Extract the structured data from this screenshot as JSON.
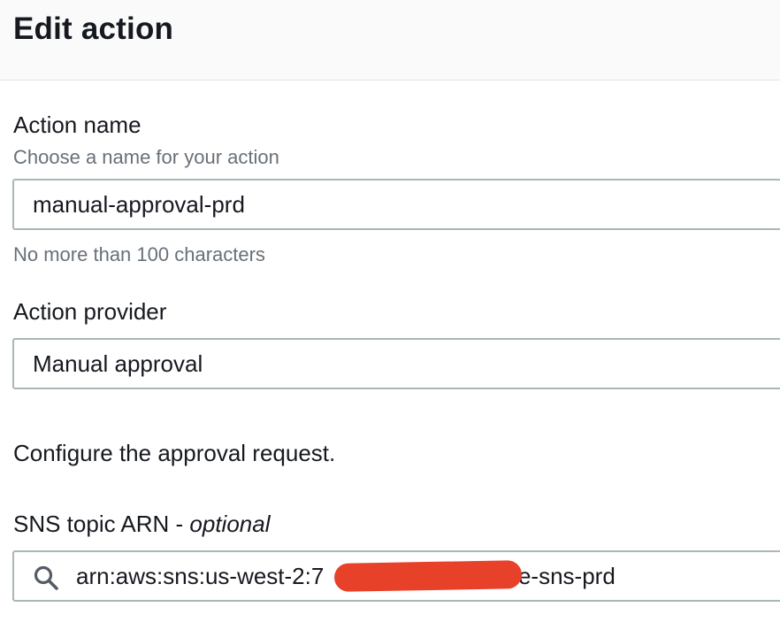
{
  "header": {
    "title": "Edit action"
  },
  "action_name": {
    "label": "Action name",
    "description": "Choose a name for your action",
    "value": "manual-approval-prd",
    "constraint": "No more than 100 characters"
  },
  "action_provider": {
    "label": "Action provider",
    "value": "Manual approval"
  },
  "approval": {
    "heading": "Configure the approval request."
  },
  "sns_topic": {
    "label": "SNS topic ARN - ",
    "label_optional": "optional",
    "value": "arn:aws:sns:us-west-2:7                    pipeline-sns-prd",
    "icon": "search-icon",
    "redaction_color": "#e8412a"
  }
}
